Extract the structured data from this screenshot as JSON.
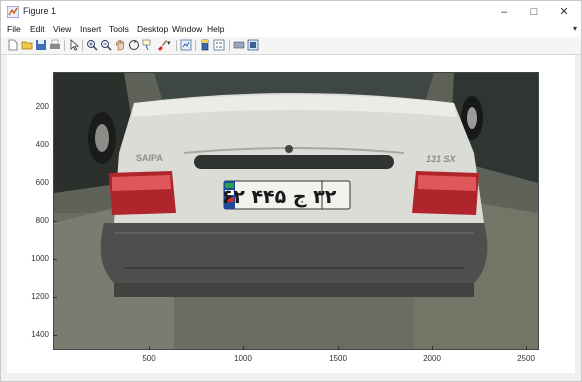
{
  "window": {
    "title": "Figure 1",
    "minimize_glyph": "–",
    "maximize_glyph": "□",
    "close_glyph": "✕"
  },
  "menu": {
    "items": [
      "File",
      "Edit",
      "View",
      "Insert",
      "Tools",
      "Desktop",
      "Window",
      "Help"
    ],
    "overflow_glyph": "▾"
  },
  "toolbar": {
    "icons": [
      "new-figure-icon",
      "open-file-icon",
      "save-icon",
      "print-icon",
      "pointer-icon",
      "zoom-in-icon",
      "zoom-out-icon",
      "pan-icon",
      "rotate-3d-icon",
      "data-cursor-icon",
      "brush-icon",
      "link-plot-icon",
      "colorbar-icon",
      "legend-icon",
      "hide-plot-tools-icon",
      "show-plot-tools-icon"
    ]
  },
  "axes": {
    "yticks": [
      "200",
      "400",
      "600",
      "800",
      "1000",
      "1200",
      "1400"
    ],
    "xticks": [
      "500",
      "1000",
      "1500",
      "2000",
      "2500"
    ]
  },
  "image": {
    "plate_text": "۳۲ ج ۴۴۵ ۶۲",
    "badge_left": "SAIPA",
    "badge_right": "131 SX"
  }
}
